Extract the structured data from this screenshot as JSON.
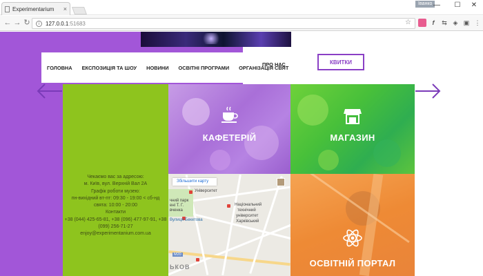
{
  "browser": {
    "tab_title": "Experimentarium",
    "tab_close": "×",
    "user_badge": "Іванко",
    "url_host": "127.0.0.1",
    "url_port": ":51683",
    "min_glyph": "—",
    "max_glyph": "☐",
    "close_glyph": "✕"
  },
  "nav": {
    "items": [
      "ГОЛОВНА",
      "ЕКСПОЗИЦІЯ ТА ШОУ",
      "НОВИНИ",
      "ОСВІТНІ ПРОГРАМИ",
      "ОРГАНІЗАЦІЯ СВЯТ"
    ],
    "about": "ПРО НАС",
    "tickets": "КВИТКИ"
  },
  "info": {
    "lines": [
      "Чекаємо вас за адресою:",
      "м. Київ, вул. Верхній Вал 2А",
      "Графік роботи музею:",
      "пн-вихідний вт-пт: 09:30 - 19:00 < сб-нд",
      "свята: 10:00 - 20:00",
      "Контакти",
      "+38 (044) 425-65-81, +38 (096) 477-97-91, +38",
      "(099) 256-71-27",
      "enjoy@experimentanium.com.ua"
    ]
  },
  "tiles": {
    "cafe": "КАФЕТЕРІЙ",
    "shop": "МАГАЗИН",
    "edu": "ОСВІТНІЙ ПОРТАЛ"
  },
  "map": {
    "zoom_link": "Збільшити карту",
    "labels": {
      "university": "Університет",
      "park1": "чний парк",
      "park2": "ені Т. Г.",
      "park3": "вченка",
      "inst1": "Національний",
      "inst2": "технічний",
      "inst3": "університет",
      "inst4": "Харківський",
      "beketova": "Вулиця Бекетова",
      "kyiv": "ЬКОВ",
      "m20": "M20"
    }
  },
  "colors": {
    "purple": "#a256d8",
    "green": "#8ec41e",
    "tickets_border": "#8a3fc5",
    "orange": "#ee8a35"
  }
}
